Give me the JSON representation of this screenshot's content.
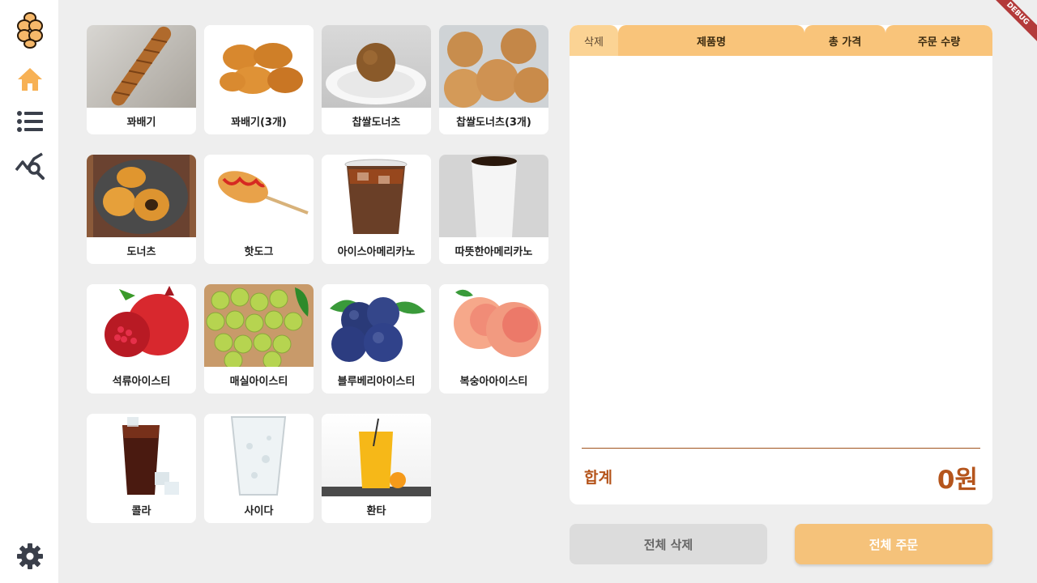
{
  "sidebar": {
    "logo": "bread-logo-icon",
    "items": [
      {
        "icon": "home-icon",
        "active": true
      },
      {
        "icon": "list-icon",
        "active": false
      },
      {
        "icon": "analytics-search-icon",
        "active": false
      }
    ],
    "settings_icon": "gear-icon"
  },
  "products": [
    {
      "name": "꽈배기",
      "image": "twisted-donut"
    },
    {
      "name": "꽈배기(3개)",
      "image": "twisted-donuts-3"
    },
    {
      "name": "찹쌀도너츠",
      "image": "rice-donut"
    },
    {
      "name": "찹쌀도너츠(3개)",
      "image": "rice-donuts-3"
    },
    {
      "name": "도너츠",
      "image": "donuts"
    },
    {
      "name": "핫도그",
      "image": "corndog"
    },
    {
      "name": "아이스아메리카노",
      "image": "iced-americano"
    },
    {
      "name": "따뜻한아메리카노",
      "image": "hot-americano"
    },
    {
      "name": "석류아이스티",
      "image": "pomegranate"
    },
    {
      "name": "매실아이스티",
      "image": "green-plums"
    },
    {
      "name": "블루베리아이스티",
      "image": "blueberries"
    },
    {
      "name": "복숭아아이스티",
      "image": "peaches"
    },
    {
      "name": "콜라",
      "image": "cola"
    },
    {
      "name": "사이다",
      "image": "cider"
    },
    {
      "name": "환타",
      "image": "fanta"
    }
  ],
  "order": {
    "columns": {
      "delete": "삭제",
      "name": "제품명",
      "price": "총 가격",
      "qty": "주문 수량"
    },
    "total_label": "합계",
    "total_value": "0원"
  },
  "buttons": {
    "clear_all": "전체 삭제",
    "order_all": "전체 주문"
  },
  "banner": "DEBUG",
  "colors": {
    "accent": "#f9c47a",
    "total": "#b5551c",
    "home_icon": "#f7b155",
    "icon": "#3a3f4a"
  }
}
